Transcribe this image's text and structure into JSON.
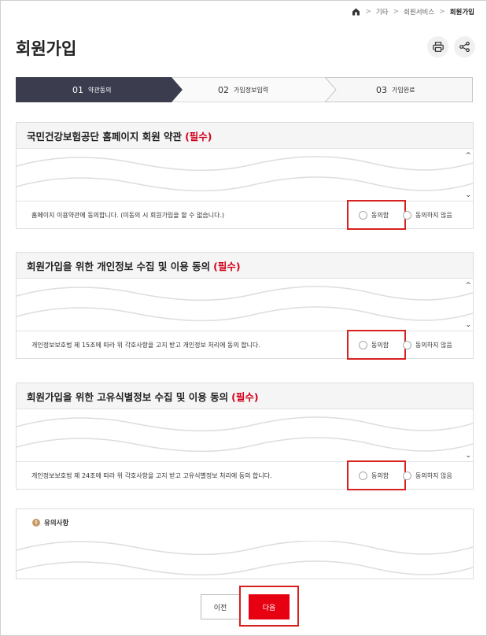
{
  "breadcrumb": {
    "items": [
      "기타",
      "회원서비스"
    ],
    "current": "회원가입",
    "separator": ">"
  },
  "page": {
    "title": "회원가입"
  },
  "toolbar": {
    "print_icon": "print-icon",
    "share_icon": "share-icon"
  },
  "steps": [
    {
      "num": "01",
      "label": "약관동의",
      "active": true
    },
    {
      "num": "02",
      "label": "가입정보입력",
      "active": false
    },
    {
      "num": "03",
      "label": "가입완료",
      "active": false
    }
  ],
  "sections": [
    {
      "title": "국민건강보험공단 홈페이지 회원 약관",
      "required": "(필수)",
      "agree_text": "홈페이지 이용약관에 동의합니다. (미동의 시 회원가입을 할 수 없습니다.)",
      "yes_label": "동의함",
      "no_label": "동의하지 않음"
    },
    {
      "title": "회원가입을 위한 개인정보 수집 및 이용 동의",
      "required": "(필수)",
      "agree_text": "개인정보보호법 제 15조에 따라 위 각호사항을 고지 받고 개인정보 처리에 동의 합니다.",
      "yes_label": "동의함",
      "no_label": "동의하지 않음"
    },
    {
      "title": "회원가입을 위한 고유식별정보 수집 및 이용 동의",
      "required": "(필수)",
      "agree_text": "개인정보보호법 제 24조에 따라 위 각호사항을 고지 받고 고유식별정보 처리에 동의 합니다.",
      "yes_label": "동의함",
      "no_label": "동의하지 않음"
    }
  ],
  "notice": {
    "title": "유의사항"
  },
  "buttons": {
    "prev": "이전",
    "next": "다음"
  },
  "colors": {
    "accent": "#e60012",
    "step_active": "#3b3c4e",
    "highlight": "#d82020"
  }
}
